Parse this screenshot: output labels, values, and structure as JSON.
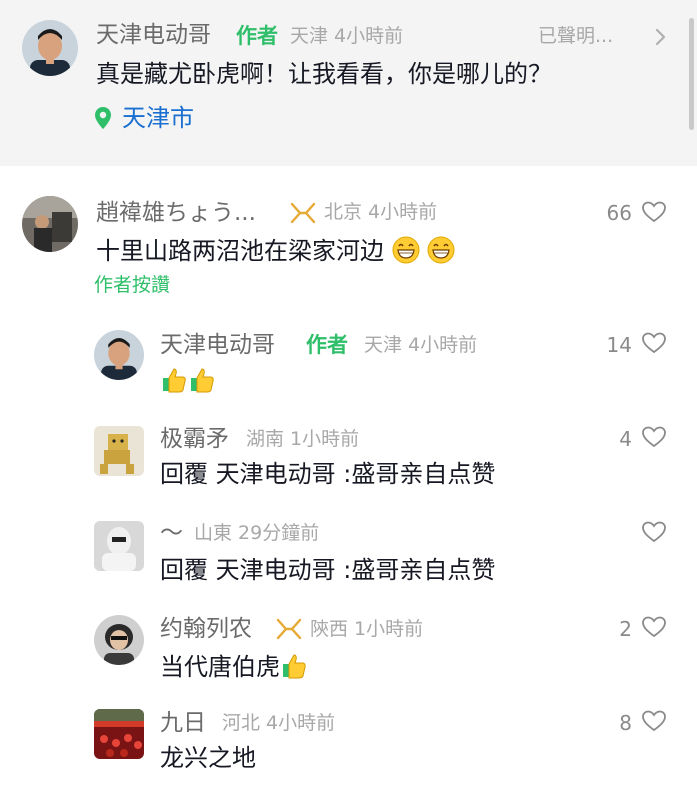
{
  "top_comment": {
    "name": "天津电动哥",
    "author_tag": "作者",
    "meta": "天津 4小時前",
    "declaration": "已聲明...",
    "text": "真是藏尤卧虎啊！让我看看，你是哪儿的？",
    "location": "天津市"
  },
  "comments": [
    {
      "name": "趙褘雄ちょう...",
      "meta": "北京 4小時前",
      "text": "十里山路两沼池在梁家河边",
      "likes": "66",
      "author_liked": "作者按讚"
    }
  ],
  "replies": [
    {
      "name": "天津电动哥",
      "author_tag": "作者",
      "meta": "天津 4小時前",
      "text": "",
      "likes": "14"
    },
    {
      "name": "极霸矛",
      "meta": "湖南 1小時前",
      "text": "回覆 天津电动哥 :盛哥亲自点赞",
      "likes": "4"
    },
    {
      "name": "〜",
      "meta": "山東 29分鐘前",
      "text": "回覆 天津电动哥 :盛哥亲自点赞",
      "likes": ""
    },
    {
      "name": "约翰列农",
      "meta": "陝西 1小時前",
      "text": "当代唐伯虎",
      "likes": "2"
    },
    {
      "name": "九日",
      "meta": "河北 4小時前",
      "text": "龙兴之地",
      "likes": "8"
    }
  ],
  "colors": {
    "author_green": "#2fbf6a",
    "location_blue": "#1a6fd1",
    "badge_gold": "#e6a934"
  },
  "icons": [
    "location-pin-icon",
    "chevron-right-icon",
    "heart-icon",
    "badge-icon",
    "grin-emoji",
    "thumbs-up-emoji"
  ]
}
